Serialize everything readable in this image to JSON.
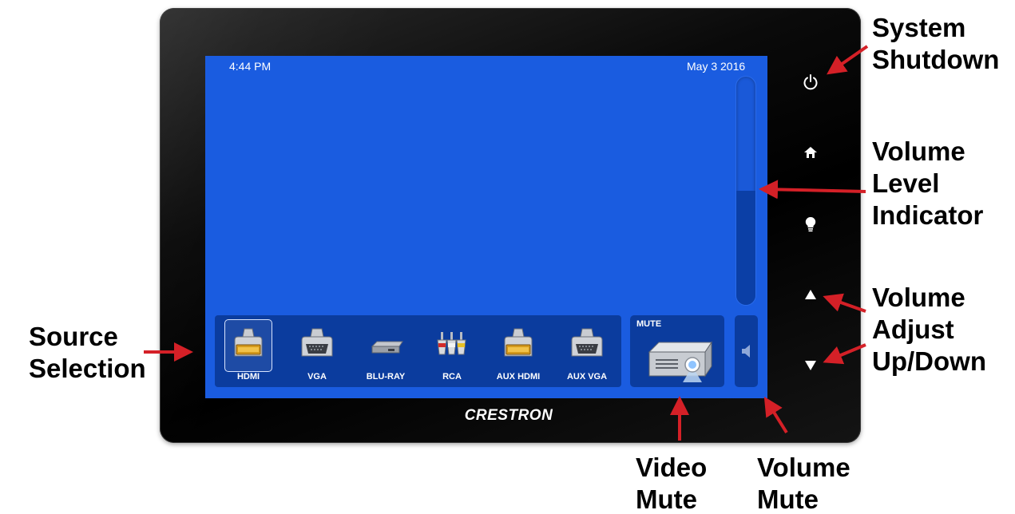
{
  "screen": {
    "time": "4:44 PM",
    "date": "May 3 2016",
    "background_color": "#1a5ce0",
    "volume_level_percent": 50
  },
  "sources": [
    {
      "label": "HDMI",
      "icon": "hdmi-icon",
      "selected": true
    },
    {
      "label": "VGA",
      "icon": "vga-icon",
      "selected": false
    },
    {
      "label": "BLU-RAY",
      "icon": "blu-ray-player-icon",
      "selected": false
    },
    {
      "label": "RCA",
      "icon": "rca-icon",
      "selected": false
    },
    {
      "label": "AUX HDMI",
      "icon": "hdmi-icon",
      "selected": false
    },
    {
      "label": "AUX VGA",
      "icon": "vga-icon",
      "selected": false
    }
  ],
  "video_mute": {
    "label": "MUTE",
    "icon": "projector-icon"
  },
  "volume_mute": {
    "icon": "speaker-icon"
  },
  "hard_buttons": [
    {
      "icon": "power-icon"
    },
    {
      "icon": "home-icon"
    },
    {
      "icon": "lightbulb-icon"
    },
    {
      "icon": "triangle-up-icon"
    },
    {
      "icon": "triangle-down-icon"
    }
  ],
  "brand": "CRESTRON",
  "callouts": {
    "system_shutdown": [
      "System",
      "Shutdown"
    ],
    "volume_level": [
      "Volume",
      "Level",
      "Indicator"
    ],
    "volume_adjust": [
      "Volume",
      "Adjust",
      "Up/Down"
    ],
    "source_selection": [
      "Source",
      "Selection"
    ],
    "video_mute": [
      "Video",
      "Mute"
    ],
    "volume_mute": [
      "Volume",
      "Mute"
    ]
  },
  "colors": {
    "arrow": "#d42027",
    "panel": "#0b3c9e"
  }
}
